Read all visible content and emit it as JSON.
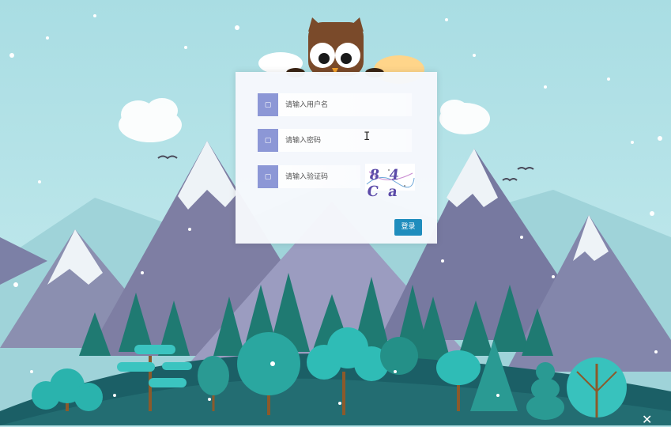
{
  "login": {
    "username_placeholder": "请输入用户名",
    "password_placeholder": "请输入密码",
    "captcha_placeholder": "请输入验证码",
    "captcha_code": "8 4 C a",
    "login_label": "登录",
    "user_icon": "user-icon",
    "lock_icon": "lock-icon",
    "captcha_icon": "shield-icon"
  },
  "colors": {
    "sky": "#b6e3e8",
    "icon_box": "#8c97d6",
    "login_button": "#1f8dbd"
  }
}
